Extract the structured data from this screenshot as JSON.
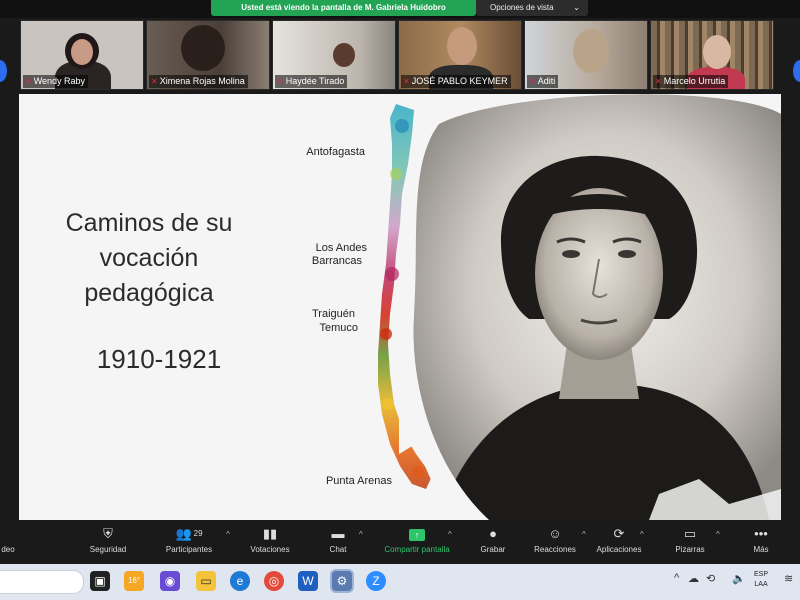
{
  "banner": {
    "share_text": "Usted está viendo la pantalla de M. Gabriela Huidobro",
    "view_options": "Opciones de vista"
  },
  "participants": [
    {
      "name": "Wendy Raby"
    },
    {
      "name": "Ximena Rojas Molina"
    },
    {
      "name": "Haydée Tirado"
    },
    {
      "name": "JOSÉ PABLO KEYMER"
    },
    {
      "name": "Aditi"
    },
    {
      "name": "Marcelo Urrutia"
    }
  ],
  "slide": {
    "title_lines": [
      "Caminos de su",
      "vocación",
      "pedagógica"
    ],
    "years": "1910-1921",
    "places": {
      "antofagasta": "Antofagasta",
      "los_andes": "Los Andes",
      "barrancas": "Barrancas",
      "traiguen": "Traiguén",
      "temuco": "Temuco",
      "punta_arenas": "Punta Arenas"
    }
  },
  "toolbar": {
    "partial_left": "deo",
    "security": "Seguridad",
    "participants": "Participantes",
    "participants_count": "29",
    "polls": "Votaciones",
    "chat": "Chat",
    "share": "Compartir pantalla",
    "record": "Grabar",
    "reactions": "Reacciones",
    "apps": "Aplicaciones",
    "whiteboards": "Pizarras",
    "more": "Más"
  },
  "taskbar": {
    "weather": "16°",
    "lang_top": "ESP",
    "lang_bottom": "LAA",
    "colors": {
      "share_green": "#23a455",
      "accent_blue": "#2d6cf0"
    }
  }
}
